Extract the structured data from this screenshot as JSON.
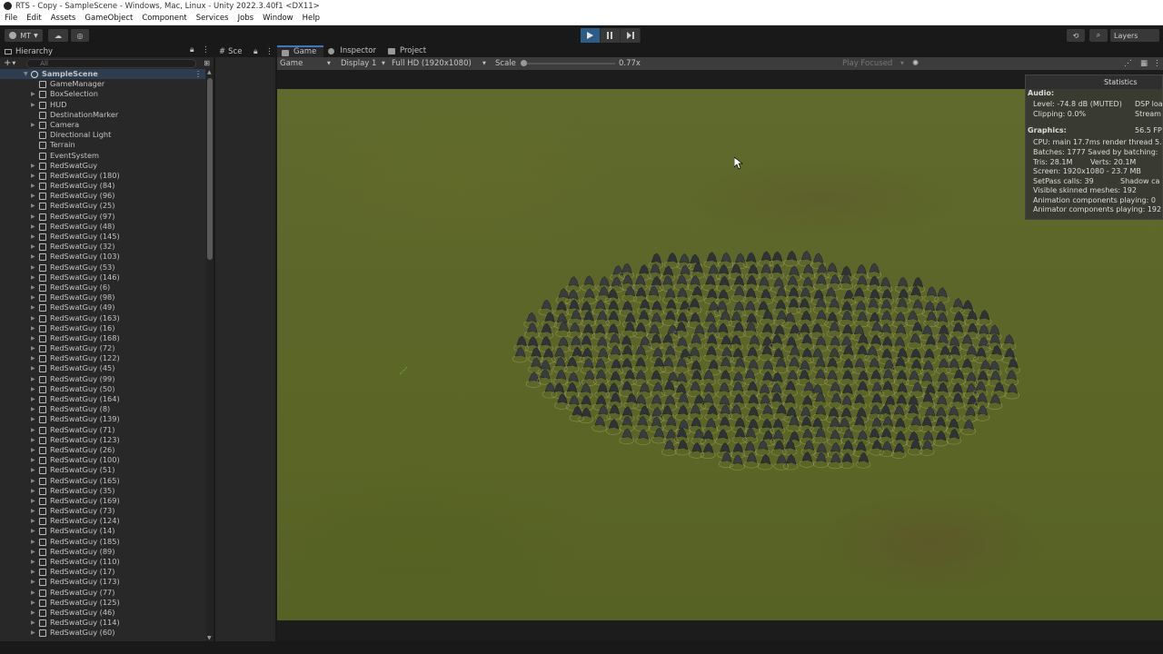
{
  "window": {
    "title": "RTS - Copy - SampleScene - Windows, Mac, Linux - Unity 2022.3.40f1 <DX11>"
  },
  "menu": [
    "File",
    "Edit",
    "Assets",
    "GameObject",
    "Component",
    "Services",
    "Jobs",
    "Window",
    "Help"
  ],
  "toolbar": {
    "account": "MT",
    "layers": "Layers"
  },
  "hierarchy": {
    "tab": "Hierarchy",
    "search_placeholder": "All",
    "scene": "SampleScene",
    "items": [
      "GameManager",
      "BoxSelection",
      "HUD",
      "DestinationMarker",
      "Camera",
      "Directional Light",
      "Terrain",
      "EventSystem",
      "RedSwatGuy",
      "RedSwatGuy (180)",
      "RedSwatGuy (84)",
      "RedSwatGuy (96)",
      "RedSwatGuy (25)",
      "RedSwatGuy (97)",
      "RedSwatGuy (48)",
      "RedSwatGuy (145)",
      "RedSwatGuy (32)",
      "RedSwatGuy (103)",
      "RedSwatGuy (53)",
      "RedSwatGuy (146)",
      "RedSwatGuy (6)",
      "RedSwatGuy (98)",
      "RedSwatGuy (49)",
      "RedSwatGuy (163)",
      "RedSwatGuy (16)",
      "RedSwatGuy (168)",
      "RedSwatGuy (72)",
      "RedSwatGuy (122)",
      "RedSwatGuy (45)",
      "RedSwatGuy (99)",
      "RedSwatGuy (50)",
      "RedSwatGuy (164)",
      "RedSwatGuy (8)",
      "RedSwatGuy (139)",
      "RedSwatGuy (71)",
      "RedSwatGuy (123)",
      "RedSwatGuy (26)",
      "RedSwatGuy (100)",
      "RedSwatGuy (51)",
      "RedSwatGuy (165)",
      "RedSwatGuy (35)",
      "RedSwatGuy (169)",
      "RedSwatGuy (73)",
      "RedSwatGuy (124)",
      "RedSwatGuy (14)",
      "RedSwatGuy (185)",
      "RedSwatGuy (89)",
      "RedSwatGuy (110)",
      "RedSwatGuy (17)",
      "RedSwatGuy (173)",
      "RedSwatGuy (77)",
      "RedSwatGuy (125)",
      "RedSwatGuy (46)",
      "RedSwatGuy (114)",
      "RedSwatGuy (60)"
    ],
    "arrow_items": [
      1,
      2,
      4,
      8,
      9,
      10,
      11,
      12,
      13,
      14,
      15,
      16,
      17,
      18,
      19,
      20,
      21,
      22,
      23,
      24,
      25,
      26,
      27,
      28,
      29,
      30,
      31,
      32,
      33,
      34,
      35,
      36,
      37,
      38,
      39,
      40,
      41,
      42,
      43,
      44,
      45,
      46,
      47,
      48,
      49,
      50,
      51,
      52,
      53,
      54
    ]
  },
  "scene_tab": "Sce",
  "game": {
    "tabs": [
      "Game",
      "Inspector",
      "Project"
    ],
    "mode": "Game",
    "display": "Display 1",
    "resolution": "Full HD (1920x1080)",
    "scale_label": "Scale",
    "scale_value": "0.77x",
    "play_focused": "Play Focused"
  },
  "statistics": {
    "title": "Statistics",
    "audio_header": "Audio:",
    "level": "Level: -74.8 dB (MUTED)",
    "dsp": "DSP loa",
    "clipping": "Clipping: 0.0%",
    "stream": "Stream",
    "graphics_header": "Graphics:",
    "fps": "56.5 FP",
    "cpu": "CPU: main 17.7ms  render thread 5.2",
    "batches": "Batches: 1777   Saved by batching:",
    "tris": "Tris: 28.1M",
    "verts": "Verts: 20.1M",
    "screen": "Screen: 1920x1080 - 23.7 MB",
    "setpass": "SetPass calls: 39",
    "shadow": "Shadow ca",
    "skinned": "Visible skinned meshes: 192",
    "anim": "Animation components playing: 0",
    "animator": "Animator components playing: 192"
  },
  "colors": {
    "accent": "#3a79bb",
    "play_active": "#2c5d87",
    "ground": "#5c6628"
  }
}
